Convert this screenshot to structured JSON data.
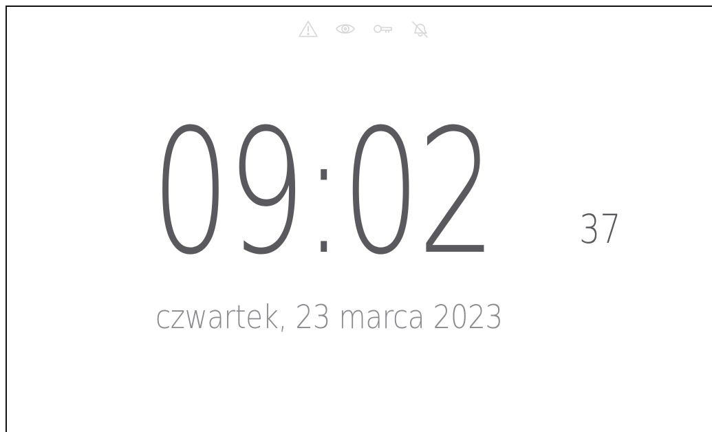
{
  "status_icons": [
    "warning-icon",
    "eye-icon",
    "key-icon",
    "bell-off-icon"
  ],
  "clock": {
    "hours_minutes": "09:02",
    "seconds": "37"
  },
  "date": "czwartek, 23 marca 2023",
  "colors": {
    "digits": "#5a5a5e",
    "date_text": "#8a8a8e",
    "icons": "#d6d6d6",
    "background": "#ffffff",
    "frame": "#111111"
  }
}
